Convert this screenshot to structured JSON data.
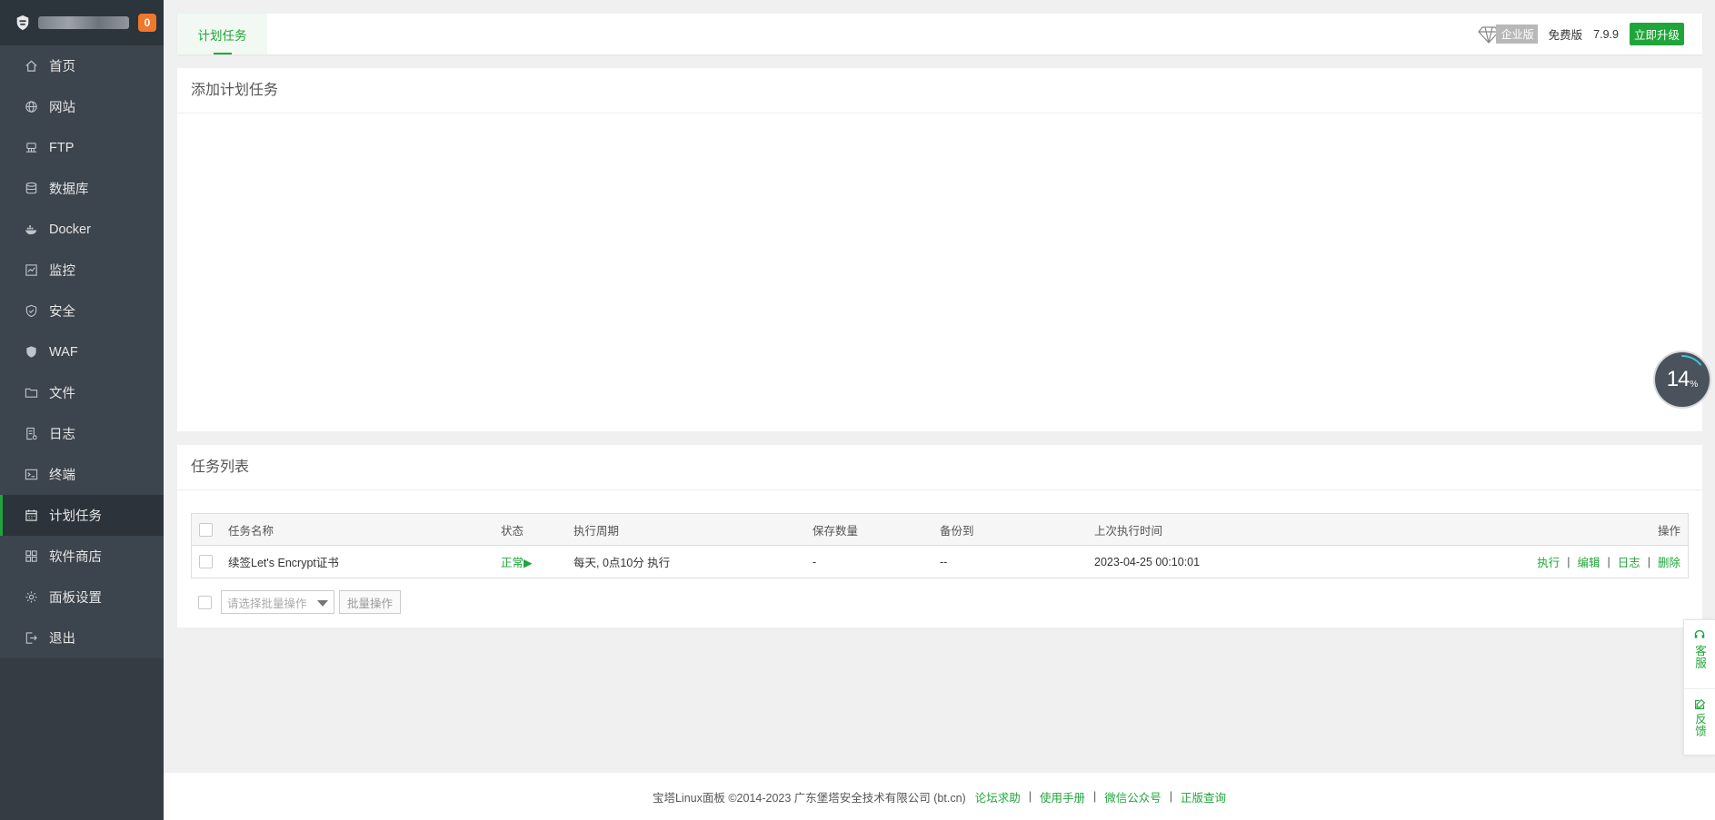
{
  "sidebar": {
    "badge": "0",
    "items": [
      {
        "label": "首页",
        "icon": "home-icon"
      },
      {
        "label": "网站",
        "icon": "globe-icon"
      },
      {
        "label": "FTP",
        "icon": "ftp-icon"
      },
      {
        "label": "数据库",
        "icon": "database-icon"
      },
      {
        "label": "Docker",
        "icon": "docker-icon"
      },
      {
        "label": "监控",
        "icon": "monitor-icon"
      },
      {
        "label": "安全",
        "icon": "shield-check-icon"
      },
      {
        "label": "WAF",
        "icon": "waf-shield-icon"
      },
      {
        "label": "文件",
        "icon": "folder-icon"
      },
      {
        "label": "日志",
        "icon": "log-icon"
      },
      {
        "label": "终端",
        "icon": "terminal-icon"
      },
      {
        "label": "计划任务",
        "icon": "calendar-icon"
      },
      {
        "label": "软件商店",
        "icon": "apps-grid-icon"
      },
      {
        "label": "面板设置",
        "icon": "gear-icon"
      },
      {
        "label": "退出",
        "icon": "logout-icon"
      }
    ],
    "active_index": 11
  },
  "topbar": {
    "tab": "计划任务",
    "enterprise": "企业版",
    "edition": "免费版",
    "version": "7.9.9",
    "upgrade": "立即升级"
  },
  "add_panel": {
    "title": "添加计划任务"
  },
  "list_panel": {
    "title": "任务列表",
    "columns": {
      "name": "任务名称",
      "status": "状态",
      "period": "执行周期",
      "keep": "保存数量",
      "backup": "备份到",
      "last": "上次执行时间",
      "ops": "操作"
    },
    "rows": [
      {
        "name": "续签Let's Encrypt证书",
        "status": "正常▶",
        "period": "每天, 0点10分 执行",
        "keep": "-",
        "backup": "--",
        "last": "2023-04-25 00:10:01",
        "ops": [
          "执行",
          "编辑",
          "日志",
          "删除"
        ]
      }
    ],
    "batch_placeholder": "请选择批量操作",
    "batch_button": "批量操作"
  },
  "progress": {
    "value": "14",
    "unit": "%",
    "fraction": 0.14
  },
  "float": {
    "service": "客服",
    "feedback": "反馈"
  },
  "footer": {
    "copyright": "宝塔Linux面板 ©2014-2023 广东堡塔安全技术有限公司 (bt.cn)",
    "links": [
      "论坛求助",
      "使用手册",
      "微信公众号",
      "正版查询"
    ]
  },
  "colors": {
    "accent": "#20a53a",
    "sidebar": "#3c444d",
    "badge": "#f0782d"
  }
}
